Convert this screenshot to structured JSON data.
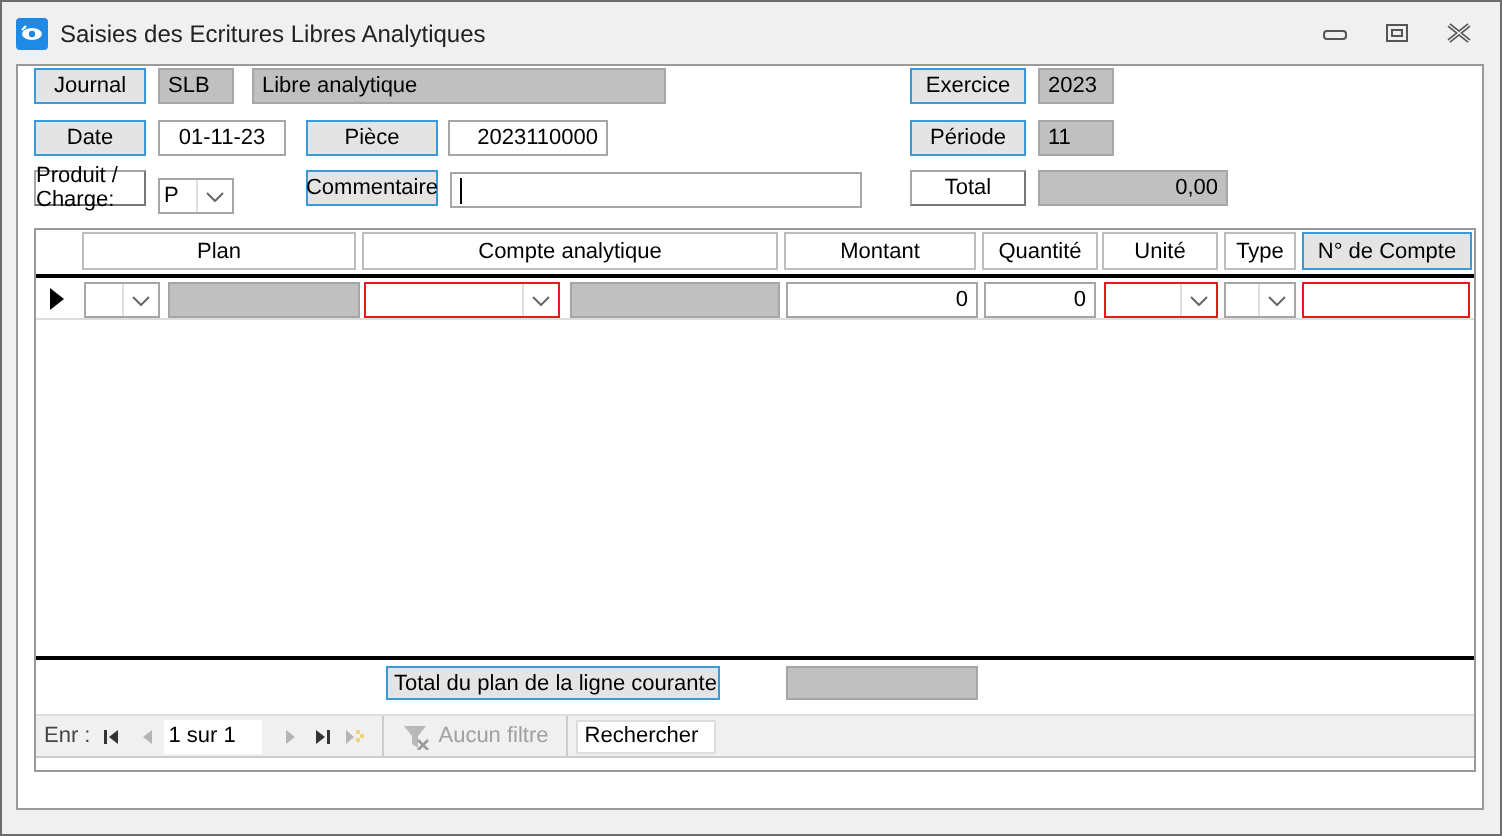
{
  "window": {
    "title": "Saisies des Ecritures Libres Analytiques"
  },
  "header": {
    "journal": {
      "label": "Journal",
      "kind": "button",
      "code": "SLB",
      "name": "Libre analytique"
    },
    "exercice": {
      "label": "Exercice",
      "kind": "button",
      "value": "2023"
    },
    "date": {
      "label": "Date",
      "kind": "button",
      "value": "01-11-23"
    },
    "piece": {
      "label": "Pièce",
      "kind": "button",
      "value": "2023110000"
    },
    "periode": {
      "label": "Période",
      "kind": "button",
      "value": "11"
    },
    "produit_charge": {
      "label": "Produit / Charge:",
      "kind": "plain",
      "value": "P"
    },
    "commentaire": {
      "label": "Commentaire",
      "kind": "button"
    },
    "total": {
      "label": "Total",
      "kind": "plain",
      "value": "0,00"
    }
  },
  "grid": {
    "columns": [
      {
        "label": "Plan",
        "selected": false
      },
      {
        "label": "Compte analytique",
        "selected": false
      },
      {
        "label": "Montant",
        "selected": false
      },
      {
        "label": "Quantité",
        "selected": false
      },
      {
        "label": "Unité",
        "selected": false
      },
      {
        "label": "Type",
        "selected": false
      },
      {
        "label": "N° de Compte",
        "selected": true
      }
    ],
    "rows": [
      {
        "current": true,
        "cells": [
          {
            "kind": "lookup",
            "error": false
          },
          {
            "kind": "lookup",
            "error": true
          },
          {
            "kind": "number",
            "error": false,
            "value": "0"
          },
          {
            "kind": "number",
            "error": false,
            "value": "0"
          },
          {
            "kind": "combo",
            "error": true
          },
          {
            "kind": "combo",
            "error": false
          },
          {
            "kind": "text",
            "error": true
          }
        ]
      }
    ],
    "footer": {
      "label": "Total du plan de la ligne courante",
      "kind": "button"
    }
  },
  "navigation": {
    "label": "Enr :",
    "position": "1 sur 1",
    "buttons": [
      {
        "kind": "first",
        "disabled": false
      },
      {
        "kind": "previous",
        "disabled": true
      },
      {
        "kind": "next",
        "disabled": true
      },
      {
        "kind": "last",
        "disabled": false
      },
      {
        "kind": "new",
        "disabled": true
      }
    ],
    "filter": {
      "label": "Aucun filtre",
      "disabled": true
    },
    "search": {
      "placeholder": "Rechercher"
    }
  }
}
